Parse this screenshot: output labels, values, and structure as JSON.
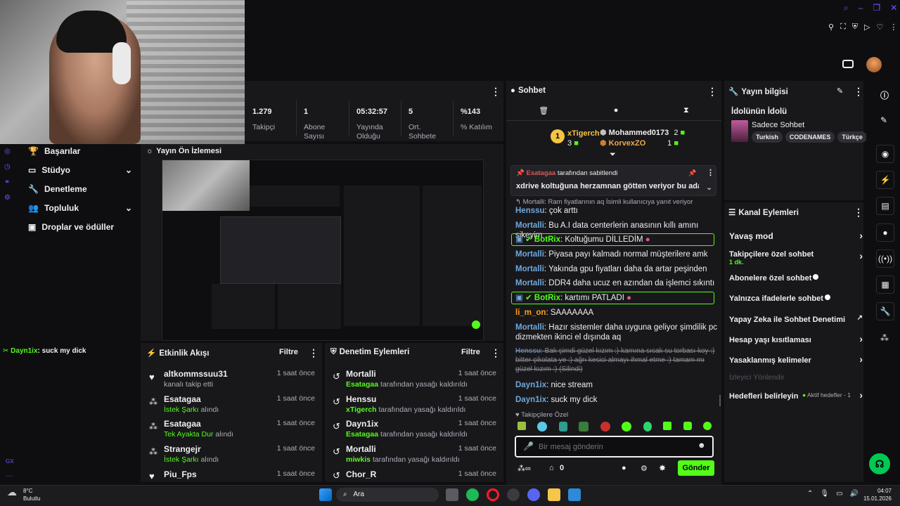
{
  "stats": [
    {
      "value": "1.279",
      "label": "Takipçi"
    },
    {
      "value": "1",
      "label": "Abone Sayısı"
    },
    {
      "value": "05:32:57",
      "label": "Yayında Olduğu"
    },
    {
      "value": "5",
      "label": "Ort. Sohbete"
    },
    {
      "value": "%143",
      "label": "% Katılım"
    }
  ],
  "left_nav": [
    "Başarılar",
    "Stüdyo",
    "Denetleme",
    "Topluluk",
    "Droplar ve ödüller"
  ],
  "preview_title": "Yayın Ön İzlemesi",
  "left_chat": {
    "user": "Dayn1ix",
    "text": ": suck my dick"
  },
  "left_bottom_label": "GX",
  "chat": {
    "title": "Sohbet",
    "top": {
      "first": {
        "rank": "1",
        "name": "xTigerch",
        "count": "3"
      },
      "second": {
        "name": "Mohammed0173",
        "count": "2"
      },
      "third": {
        "name": "KorvexZO",
        "count": "1"
      }
    },
    "pinned": {
      "by": "Esatagaa",
      "label": "tarafından sabitlendi",
      "text": "xdrive koltuğuna herzamnan götten veriyor bu adam aktif"
    },
    "reply_hint": "Mortalli: Ram fiyatlarının aq İsimli kullanıcıya yanıt veriyor",
    "messages": [
      {
        "user": "Henssu",
        "text": ": çok arttı"
      },
      {
        "user": "Mortalli",
        "text": ": Bu A.I data centerlerin anasının kıllı amını sikeyim"
      },
      {
        "user": "BotRix",
        "text": ": Koltuğumu DİLLEDİM"
      },
      {
        "user": "Mortalli",
        "text": ": Piyasa payı kalmadı normal müşterilere amk"
      },
      {
        "user": "Mortalli",
        "text": ": Yakında gpu fiyatları daha da artar peşinden"
      },
      {
        "user": "Mortalli",
        "text": ": DDR4 daha ucuz en azından da işlemci sıkıntı"
      },
      {
        "user": "BotRix",
        "text": ": kartımı PATLADI"
      },
      {
        "user": "li_m_on",
        "text": ": SAAAAAAA"
      },
      {
        "user": "Mortalli",
        "text": ": Hazır sistemler daha uyguna geliyor şimdilik pc dizmekten ikinci el dışında aq"
      },
      {
        "user": "Henssu",
        "text": ": Bak şimdi güzel kızım :) karnına sıcak su torbası koy :) bitter çikolata ye :) ağrı kesici almayı ihmal etme :) tamam mı güzel kızım :) (Silindi)"
      },
      {
        "user": "Dayn1ix",
        "text": ": nice stream"
      },
      {
        "user": "Dayn1ix",
        "text": ": suck my dick"
      }
    ],
    "followers_label": "Takipçilere Özel",
    "input_placeholder": "Bir mesaj gönderin",
    "points": "0",
    "send_label": "Gönder"
  },
  "activity": {
    "title": "Etkinlik Akışı",
    "filter": "Filtre",
    "items": [
      {
        "name": "altkommssuu31",
        "sub": "kanalı takip etti",
        "time": "1 saat önce"
      },
      {
        "name": "Esatagaa",
        "sub_green": "İstek Şarkı",
        "sub": " alındı",
        "time": "1 saat önce"
      },
      {
        "name": "Esatagaa",
        "sub_green": "Tek Ayakta Dur",
        "sub": " alındı",
        "time": "1 saat önce"
      },
      {
        "name": "Strangejr",
        "sub_green": "İstek Şarkı",
        "sub": " alındı",
        "time": "1 saat önce"
      },
      {
        "name": "Piu_Fps",
        "sub": "",
        "time": "1 saat önce"
      }
    ]
  },
  "moderation": {
    "title": "Denetim Eylemleri",
    "filter": "Filtre",
    "items": [
      {
        "name": "Mortalli",
        "sub_green": "Esatagaa",
        "sub": " tarafından yasağı kaldırıldı",
        "time": "1 saat önce"
      },
      {
        "name": "Henssu",
        "sub_green": "xTigerch",
        "sub": " tarafından yasağı kaldırıldı",
        "time": "1 saat önce"
      },
      {
        "name": "Dayn1ix",
        "sub_green": "Esatagaa",
        "sub": " tarafından yasağı kaldırıldı",
        "time": "1 saat önce"
      },
      {
        "name": "Mortalli",
        "sub_green": "miwkis",
        "sub": " tarafından yasağı kaldırıldı",
        "time": "1 saat önce"
      },
      {
        "name": "Chor_R",
        "sub": "",
        "time": "1 saat önce"
      }
    ]
  },
  "stream_info": {
    "title": "Yayın bilgisi",
    "stream_title": "İdolünün İdolü",
    "category": "Sadece Sohbet",
    "tags": [
      "Turkish",
      "CODENAMES",
      "Türkçe"
    ]
  },
  "channel_actions": {
    "title": "Kanal Eylemleri",
    "items": [
      {
        "label": "Yavaş mod",
        "control": "chevron"
      },
      {
        "label": "Takipçilere özel sohbet",
        "sub": "1 dk.",
        "control": "chevron"
      },
      {
        "label": "Abonelere özel sohbet",
        "control": "toggle"
      },
      {
        "label": "Yalnızca ifadelerle sohbet",
        "control": "toggle"
      },
      {
        "label": "Yapay Zeka ile Sohbet Denetimi",
        "control": "external"
      },
      {
        "label": "Hesap yaşı kısıtlaması",
        "control": "chevron"
      },
      {
        "label": "Yasaklanmış kelimeler",
        "control": "chevron"
      }
    ],
    "section": "İzleyici Yönlendir",
    "goals_label": "Hedefleri belirleyin",
    "goals_status": "Aktif hedefler - 1"
  },
  "taskbar": {
    "weather_temp": "8°C",
    "weather_desc": "Bulutlu",
    "search": "Ara",
    "time": "04:07",
    "date": "15.01.2026"
  },
  "colors": {
    "accent": "#53fc18",
    "panel": "#18181b",
    "bg": "#0e0e10"
  }
}
